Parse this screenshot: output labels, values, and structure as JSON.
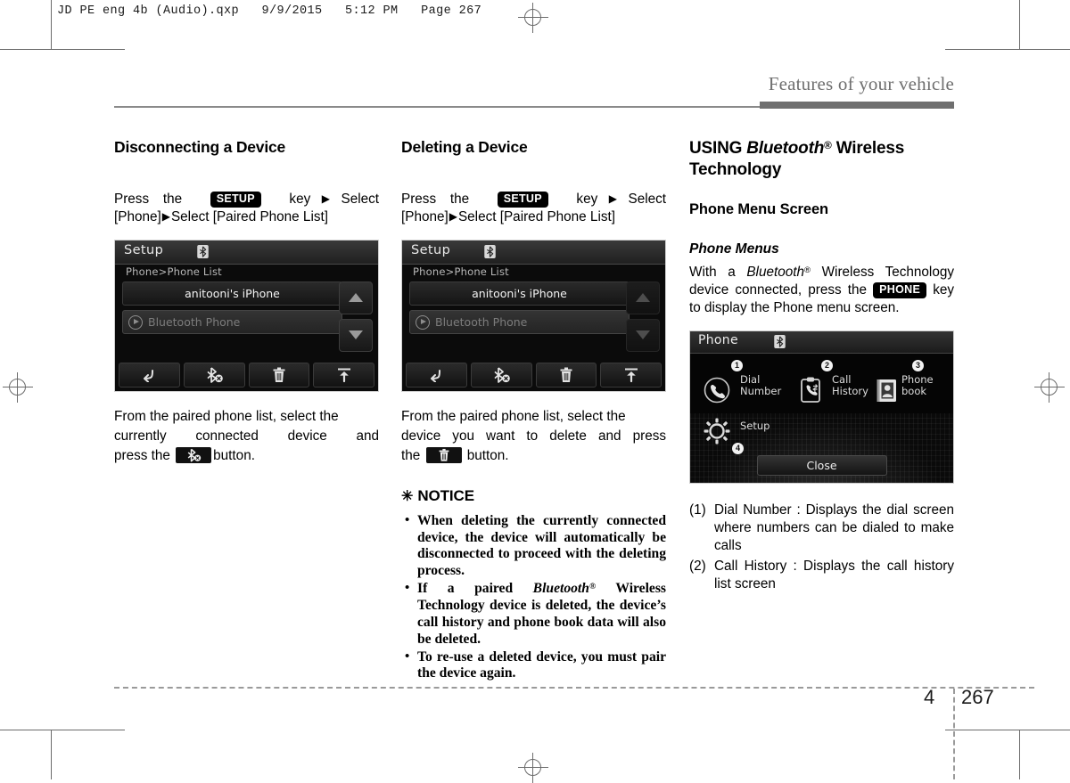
{
  "print_marks": {
    "file_header": "JD PE eng 4b (Audio).qxp   9/9/2015   5:12 PM   Page 267"
  },
  "running_head": {
    "title": "Features of your vehicle"
  },
  "footer": {
    "chapter": "4",
    "page": "267"
  },
  "columns": {
    "col1": {
      "heading": "Disconnecting a Device",
      "instruction": {
        "before": "Press   the",
        "key": "SETUP",
        "after_key": "key",
        "tail": "Select [Phone]",
        "tail2": "Select [Paired Phone List]"
      },
      "caption_line1": "From the paired phone list, select the",
      "caption_line2": "currently  connected  device  and",
      "caption_line3_before": "press the",
      "caption_line3_after": "button."
    },
    "col2": {
      "heading": "Deleting a Device",
      "instruction": {
        "before": "Press   the",
        "key": "SETUP",
        "after_key": "key",
        "tail": "Select [Phone]",
        "tail2": "Select [Paired Phone List]"
      },
      "caption_line1": "From the paired phone list, select the",
      "caption_line2": "device you want to delete and press",
      "caption_line3_before": "the",
      "caption_line3_after": "button.",
      "notice": {
        "star": "✳",
        "title": "NOTICE",
        "items": [
          "When deleting the currently connected device, the device will automatically be disconnected to proceed with the deleting process.",
          "If a paired Bluetooth® Wireless Technology device is deleted, the device’s call history and phone book data will also be deleted.",
          "To re-use a deleted device, you must pair the device again."
        ],
        "item2_parts": {
          "pre": "If a paired ",
          "brand": "Bluetooth",
          "sup": "®",
          "post": " Wireless Technology device is deleted, the device’s call history and phone book data will also be deleted."
        }
      }
    },
    "col3": {
      "heading_pre": "USING ",
      "heading_brand": "Bluetooth",
      "heading_sup": "®",
      "heading_post": " Wireless Technology",
      "subheading": "Phone Menu Screen",
      "italic_head": "Phone Menus",
      "para": {
        "pre": "With a ",
        "brand": "Bluetooth",
        "sup": "®",
        "mid": " Wireless Technology device connected, press the ",
        "key": "PHONE",
        "post": " key to display the Phone menu screen."
      },
      "definitions": [
        {
          "num": "(1)",
          "text": "Dial Number : Displays the dial screen where numbers can be dialed to make calls"
        },
        {
          "num": "(2)",
          "text": "Call History : Displays the call history list screen"
        }
      ]
    }
  },
  "setup_screen": {
    "title": "Setup",
    "breadcrumb": "Phone>Phone List",
    "rows": [
      {
        "label": "anitooni's iPhone",
        "state": "selected"
      },
      {
        "label": "Bluetooth Phone",
        "state": "dimmed"
      }
    ],
    "scroll": {
      "up": "scroll-up",
      "down": "scroll-down"
    },
    "toolbar": [
      {
        "icon": "back-arrow-icon",
        "name": "back"
      },
      {
        "icon": "bluetooth-disconnect-icon",
        "name": "disconnect"
      },
      {
        "icon": "trash-icon",
        "name": "delete"
      },
      {
        "icon": "upload-icon",
        "name": "connect"
      }
    ]
  },
  "phone_screen": {
    "title": "Phone",
    "items": [
      {
        "callout": "1",
        "label_line1": "Dial",
        "label_line2": "Number",
        "icon": "handset-icon"
      },
      {
        "callout": "2",
        "label_line1": "Call",
        "label_line2": "History",
        "icon": "call-history-icon"
      },
      {
        "callout": "3",
        "label_line1": "Phone",
        "label_line2": "book",
        "icon": "phonebook-icon"
      },
      {
        "callout": "4",
        "label_line1": "Setup",
        "label_line2": "",
        "icon": "gear-icon"
      }
    ],
    "close_label": "Close"
  },
  "colors": {
    "running_head": "#6f6f6f",
    "screen_bg": "#0b0b0b",
    "key_badge_bg": "#000000"
  }
}
